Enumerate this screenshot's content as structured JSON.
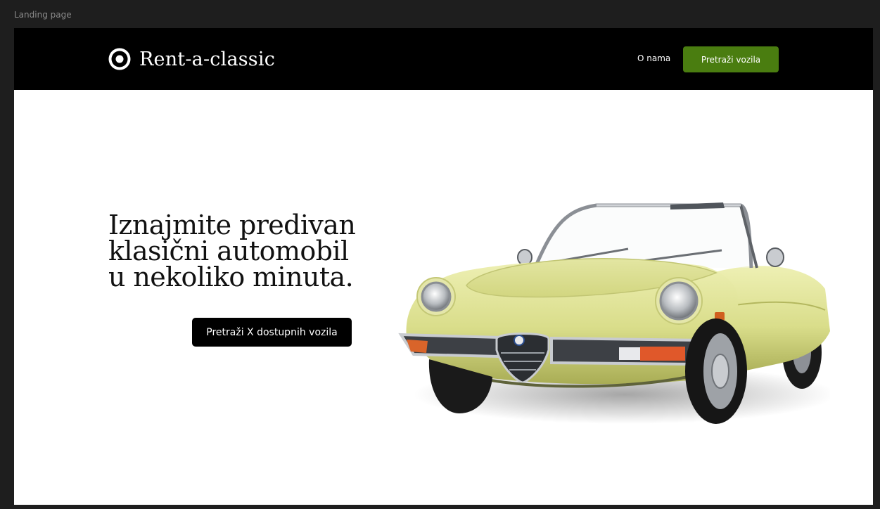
{
  "canvas": {
    "frame_label": "Landing page"
  },
  "navbar": {
    "brand": "Rent-a-classic",
    "about_link": "O nama",
    "cta_label": "Pretraži vozila"
  },
  "hero": {
    "heading_lines": [
      "Iznajmite predivan",
      "klasični automobil",
      "u nekoliko minuta."
    ],
    "cta_label": "Pretraži X dostupnih vozila"
  },
  "icons": {
    "brand_logo": "target-circle-icon"
  },
  "colors": {
    "navbar_bg": "#000000",
    "nav_cta_bg": "#4a7d10",
    "hero_cta_bg": "#000000",
    "car_body": "#d9dd8a"
  }
}
